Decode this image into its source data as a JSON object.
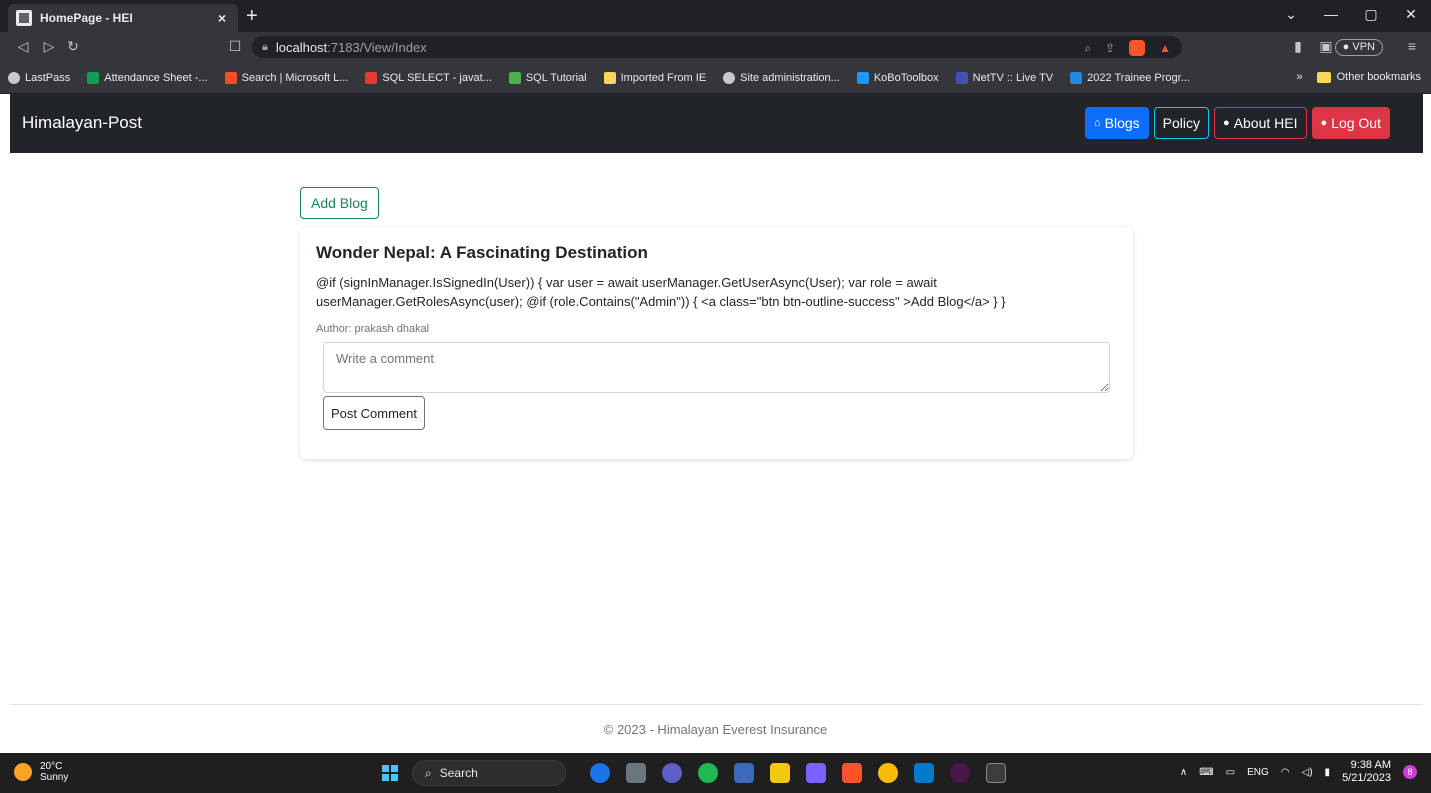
{
  "browser": {
    "tab_title": "HomePage - HEI",
    "tab_close": "×",
    "new_tab": "+",
    "window_controls": [
      "⌄",
      "—",
      "▢",
      "✕"
    ],
    "url_host": "localhost",
    "url_path": ":7183/View/Index",
    "vpn_label": "● VPN",
    "bookmarks": [
      {
        "label": "LastPass",
        "color": "#c9c9c9"
      },
      {
        "label": "Attendance Sheet -...",
        "color": "#0f9d58"
      },
      {
        "label": "Search | Microsoft L...",
        "color": "#f25022"
      },
      {
        "label": "SQL SELECT - javat...",
        "color": "#e53935"
      },
      {
        "label": "SQL Tutorial",
        "color": "#4caf50"
      },
      {
        "label": "Imported From IE",
        "color": "#f9d55c"
      },
      {
        "label": "Site administration...",
        "color": "#c9c9c9"
      },
      {
        "label": "KoBoToolbox",
        "color": "#2196f3"
      },
      {
        "label": "NetTV :: Live TV",
        "color": "#3f51b5"
      },
      {
        "label": "2022 Trainee Progr...",
        "color": "#1e88e5"
      }
    ],
    "more_bookmarks": "»",
    "other_bookmarks": "Other bookmarks"
  },
  "navbar": {
    "brand": "Himalayan-Post",
    "blogs_label": "Blogs",
    "policy_label": "Policy",
    "about_label": "About HEI",
    "logout_label": "Log Out"
  },
  "main": {
    "add_blog_label": "Add Blog",
    "post": {
      "title": "Wonder Nepal: A Fascinating Destination",
      "body": "@if (signInManager.IsSignedIn(User)) { var user = await userManager.GetUserAsync(User); var role = await userManager.GetRolesAsync(user); @if (role.Contains(\"Admin\")) { <a class=\"btn btn-outline-success\" >Add Blog</a> } }",
      "author": "Author: prakash dhakal",
      "comment_placeholder": "Write a comment",
      "post_comment_label": "Post Comment"
    }
  },
  "footer": {
    "text": "© 2023 - Himalayan Everest Insurance"
  },
  "taskbar": {
    "temperature": "20°C",
    "weather": "Sunny",
    "search_label": "Search",
    "language": "ENG",
    "time": "9:38 AM",
    "date": "5/21/2023",
    "notifications": "8",
    "apps": [
      "#1a73e8",
      "#6c757d",
      "#5b5fc7",
      "#1db954",
      "#3b6bb8",
      "#f2c811",
      "#7b61ff",
      "#fb542b",
      "#fbbc05",
      "#007acc",
      "#4a154b",
      "#3c3c3c"
    ]
  }
}
